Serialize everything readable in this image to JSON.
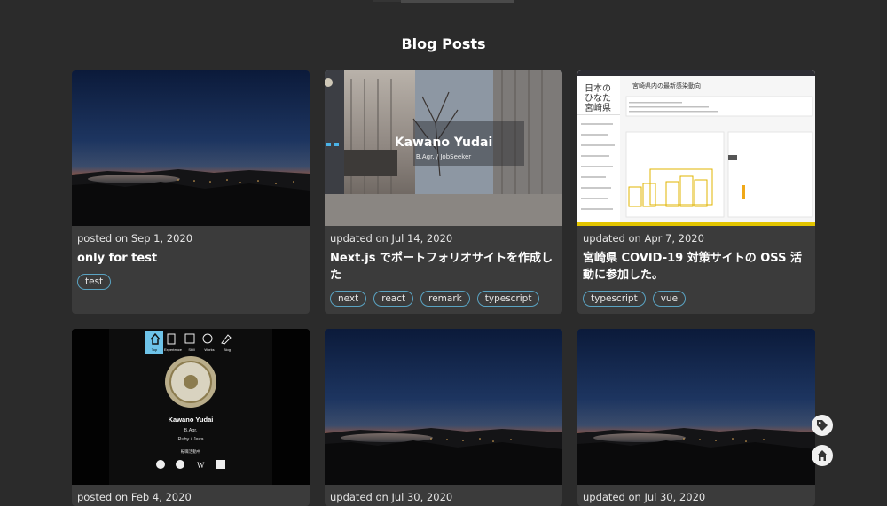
{
  "page": {
    "title": "Blog Posts"
  },
  "posts": [
    {
      "date_text": "posted on Sep 1, 2020",
      "title": "only for test",
      "tags": [
        "test"
      ],
      "thumbnail": "sunset-photo"
    },
    {
      "date_text": "updated on Jul 14, 2020",
      "title": "Next.js でポートフォリオサイトを作成した",
      "tags": [
        "next",
        "react",
        "remark",
        "typescript"
      ],
      "thumbnail": "portfolio-screenshot",
      "overlay_name": "Kawano Yudai",
      "overlay_sub": "B.Agr. / JobSeeker"
    },
    {
      "date_text": "updated on Apr 7, 2020",
      "title": "宮崎県 COVID-19 対策サイトの OSS 活動に参加した。",
      "tags": [
        "typescript",
        "vue"
      ],
      "thumbnail": "covid-site-screenshot",
      "site_heading": "宮崎県内の最新感染動向",
      "site_logo": "日本のひなた宮崎県"
    },
    {
      "date_text": "posted on Feb 4, 2020",
      "title": "",
      "tags": [],
      "thumbnail": "profile-screenshot",
      "nav_items": [
        "Top",
        "Experience",
        "Skill",
        "Works",
        "Blog"
      ],
      "profile_name": "Kawano Yudai",
      "profile_degree": "B.Agr.",
      "profile_langs": "Ruby / Java",
      "profile_status": "転職活動中"
    },
    {
      "date_text": "updated on Jul 30, 2020",
      "title": "",
      "tags": [],
      "thumbnail": "sunset-photo"
    },
    {
      "date_text": "updated on Jul 30, 2020",
      "title": "",
      "tags": [],
      "thumbnail": "sunset-photo"
    }
  ],
  "floating_buttons": {
    "tags_icon": "tag-icon",
    "home_icon": "home-icon"
  },
  "colors": {
    "background": "#2b2b2b",
    "card": "#3b3b3b",
    "tag_border": "#5aa3c2",
    "text": "#ffffff"
  }
}
